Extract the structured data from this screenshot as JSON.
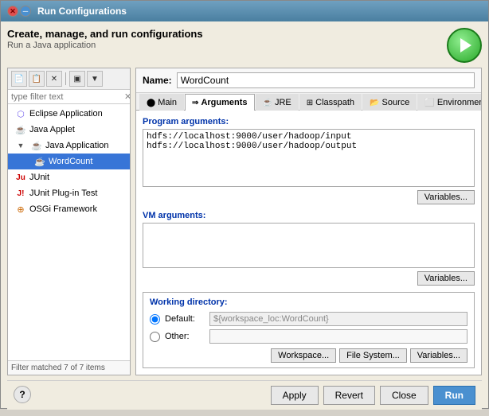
{
  "window": {
    "title": "Run Configurations",
    "header_title": "Create, manage, and run configurations",
    "header_subtitle": "Run a Java application"
  },
  "sidebar": {
    "toolbar": {
      "new_label": "📄",
      "copy_label": "📋",
      "delete_label": "✕",
      "filter1_label": "▣",
      "filter2_label": "▼"
    },
    "filter_placeholder": "type filter text",
    "tree_items": [
      {
        "id": "eclipse-app",
        "label": "Eclipse Application",
        "level": 1,
        "icon": "eclipse",
        "expanded": false
      },
      {
        "id": "java-applet",
        "label": "Java Applet",
        "level": 1,
        "icon": "applet",
        "expanded": false
      },
      {
        "id": "java-application",
        "label": "Java Application",
        "level": 1,
        "icon": "java",
        "expanded": true
      },
      {
        "id": "wordcount",
        "label": "WordCount",
        "level": 2,
        "icon": "java",
        "selected": true
      },
      {
        "id": "junit",
        "label": "JUnit",
        "level": 1,
        "icon": "junit",
        "expanded": false
      },
      {
        "id": "junit-plugin",
        "label": "JUnit Plug-in Test",
        "level": 1,
        "icon": "plugin",
        "expanded": false
      },
      {
        "id": "osgi",
        "label": "OSGi Framework",
        "level": 1,
        "icon": "osgi",
        "expanded": false
      }
    ],
    "footer": "Filter matched 7 of 7 items"
  },
  "right_panel": {
    "name_label": "Name:",
    "name_value": "WordCount",
    "tabs": [
      {
        "id": "main",
        "label": "Main",
        "icon": "⬤",
        "active": false
      },
      {
        "id": "arguments",
        "label": "Arguments",
        "icon": "⇒",
        "active": true
      },
      {
        "id": "jre",
        "label": "JRE",
        "icon": "☕",
        "active": false
      },
      {
        "id": "classpath",
        "label": "Classpath",
        "icon": "⊞",
        "active": false
      },
      {
        "id": "source",
        "label": "Source",
        "icon": "📂",
        "active": false
      },
      {
        "id": "environment",
        "label": "Environment",
        "icon": "⬜",
        "active": false
      },
      {
        "id": "more",
        "label": "»",
        "active": false
      }
    ],
    "program_args_label": "Program arguments:",
    "program_args_value": "hdfs://localhost:9000/user/hadoop/input hdfs://localhost:9000/user/hadoop/output",
    "variables_btn_1": "Variables...",
    "vm_args_label": "VM arguments:",
    "vm_args_value": "",
    "variables_btn_2": "Variables...",
    "working_dir_label": "Working directory:",
    "default_label": "Default:",
    "default_value": "${workspace_loc:WordCount}",
    "other_label": "Other:",
    "other_value": "",
    "workspace_btn": "Workspace...",
    "filesystem_btn": "File System...",
    "variables_btn_3": "Variables..."
  },
  "bottom": {
    "apply_label": "Apply",
    "revert_label": "Revert",
    "close_label": "Close",
    "run_label": "Run",
    "help_label": "?"
  }
}
